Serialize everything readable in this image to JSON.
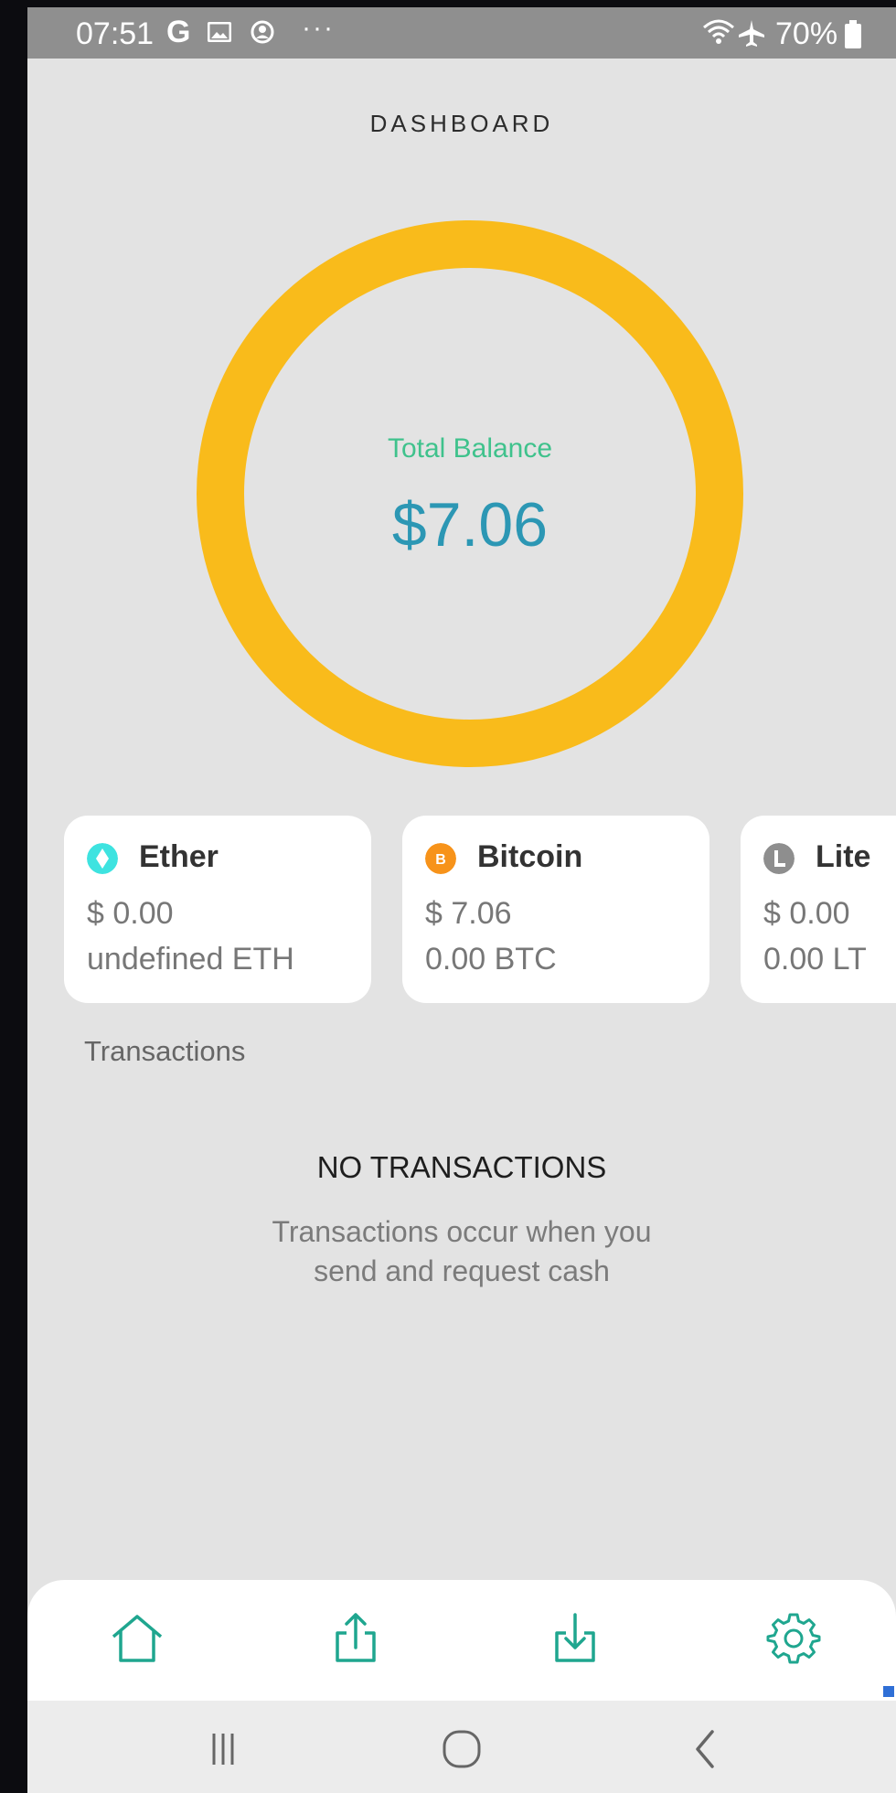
{
  "status_bar": {
    "time": "07:51",
    "notification_g": "G",
    "overflow": "···",
    "battery": "70%",
    "icons": [
      "gallery-icon",
      "account-circle-icon",
      "wifi-icon",
      "airplane-icon",
      "battery-icon"
    ]
  },
  "header": {
    "title": "DASHBOARD"
  },
  "balance": {
    "label": "Total Balance",
    "value": "$7.06",
    "ring_color": "#f9bb1b",
    "label_color": "#3fc28c",
    "value_color": "#2c97b4"
  },
  "wallets": [
    {
      "name": "Ether",
      "usd": "$ 0.00",
      "amount": "undefined ETH",
      "icon": "ether-icon",
      "icon_color": "#3ee3e0"
    },
    {
      "name": "Bitcoin",
      "usd": "$ 7.06",
      "amount": "0.00 BTC",
      "icon": "bitcoin-icon",
      "icon_color": "#f7931a"
    },
    {
      "name": "Lite",
      "usd": "$ 0.00",
      "amount": "0.00 LT",
      "icon": "litecoin-icon",
      "icon_color": "#8e8e8e"
    }
  ],
  "transactions": {
    "section_label": "Transactions",
    "empty_title": "NO TRANSACTIONS",
    "empty_description": "Transactions occur when you send and request cash"
  },
  "bottom_nav": {
    "items": [
      "home-icon",
      "send-icon",
      "receive-icon",
      "settings-icon"
    ],
    "accent_color": "#1fa68f"
  },
  "system_nav": [
    "recents-icon",
    "home-circle-icon",
    "back-icon"
  ]
}
